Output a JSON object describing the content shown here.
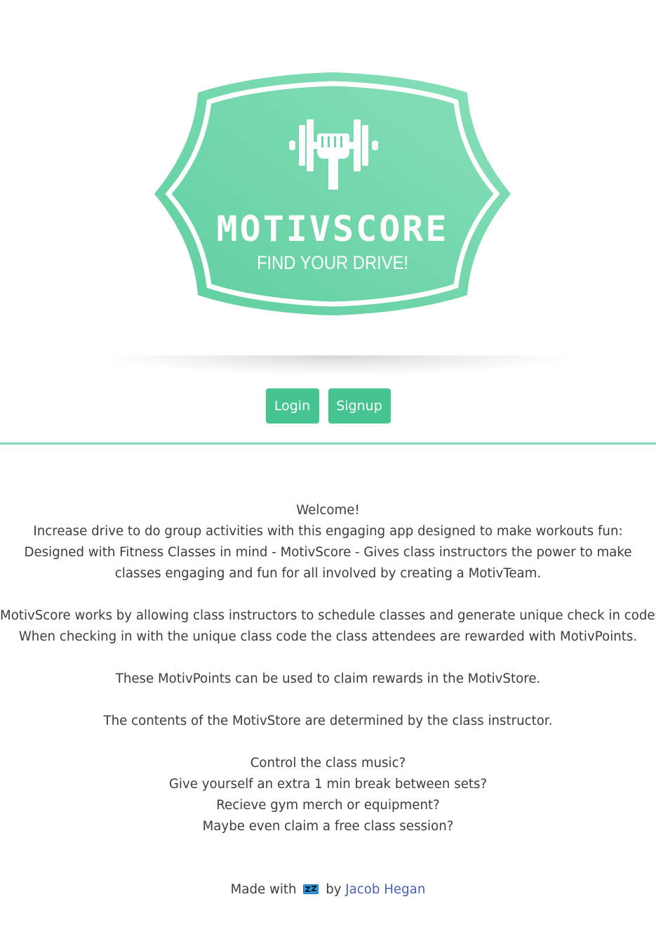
{
  "logo": {
    "brand": "MOTIVSCORE",
    "tagline": "FIND YOUR DRIVE!",
    "icon": "dumbbell-fist-icon",
    "color": "#6dd6ad"
  },
  "auth": {
    "login_label": "Login",
    "signup_label": "Signup",
    "button_color": "#45c490"
  },
  "intro": {
    "welcome": "Welcome!",
    "line1": "Increase drive to do group activities with this engaging app designed to make workouts fun:",
    "line2": "Designed with Fitness Classes in mind - MotivScore - Gives class instructors the power to make classes engaging and fun for all involved by creating a MotivTeam.",
    "line3": "MotivScore works by allowing class instructors to schedule classes and generate unique check in codes.",
    "line4": "When checking in with the unique class code the class attendees are rewarded with MotivPoints.",
    "line5": "These MotivPoints can be used to claim rewards in the MotivStore.",
    "line6": "The contents of the MotivStore are determined by the class instructor.",
    "q1": "Control the class music?",
    "q2": "Give yourself an extra 1 min break between sets?",
    "q3": "Recieve gym merch or equipment?",
    "q4": "Maybe even claim a free class session?"
  },
  "footer": {
    "prefix": "Made with",
    "icon": "sleeping-zz-icon",
    "by": "by",
    "author": "Jacob Hegan",
    "link_color": "#4a5fb5"
  }
}
